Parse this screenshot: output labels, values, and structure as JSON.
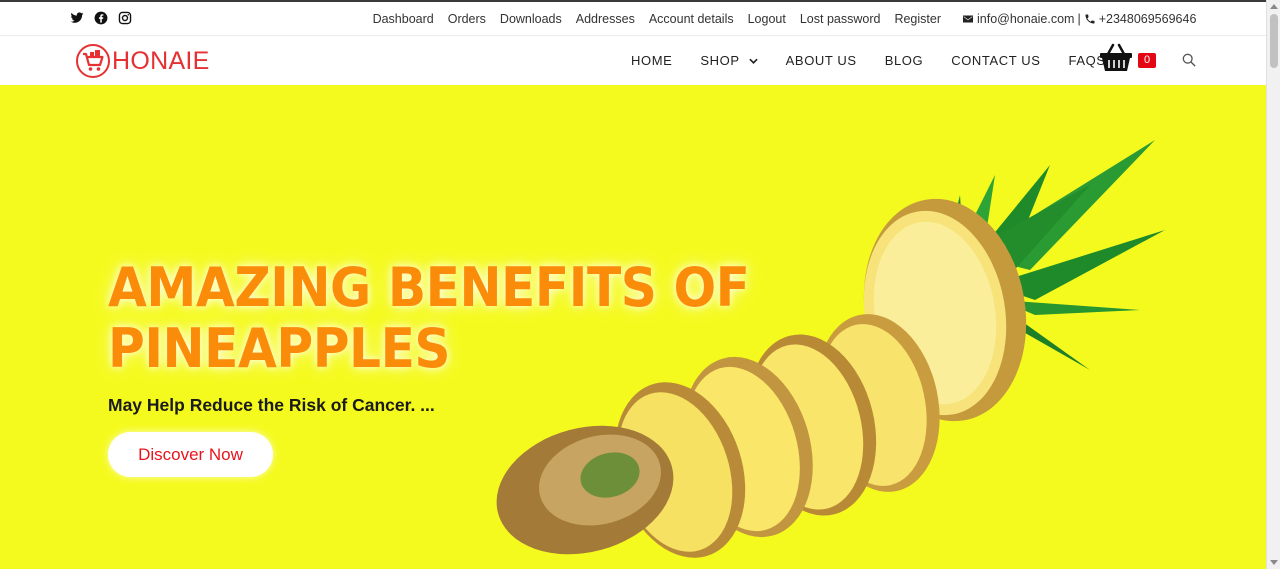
{
  "topbar": {
    "social": [
      "twitter-icon",
      "facebook-icon",
      "instagram-icon"
    ],
    "links": [
      "Dashboard",
      "Orders",
      "Downloads",
      "Addresses",
      "Account details",
      "Logout",
      "Lost password",
      "Register"
    ],
    "email": "info@honaie.com",
    "separator": "|",
    "phone": "+2348069569646"
  },
  "brand": {
    "name": "HONAIE",
    "color": "#e63133"
  },
  "nav": {
    "items": [
      "HOME",
      "SHOP",
      "ABOUT US",
      "BLOG",
      "CONTACT US",
      "FAQS"
    ],
    "cart_count": "0"
  },
  "hero": {
    "headline_line1": "AMAZING BENEFITS OF",
    "headline_line2": "PINEAPPLES",
    "subline": "May Help Reduce the Risk of Cancer. ...",
    "cta_label": "Discover Now",
    "background": "#f5fa1e",
    "headline_color": "#fb8c0a",
    "cta_text_color": "#e8141c"
  }
}
